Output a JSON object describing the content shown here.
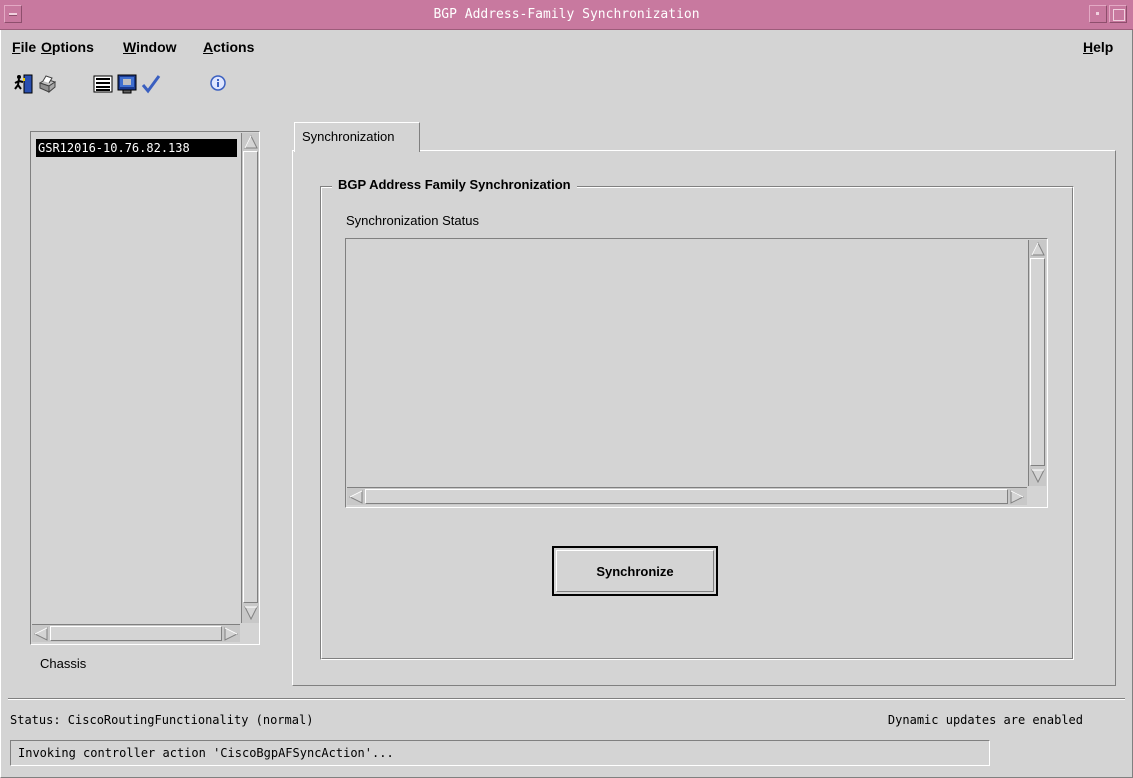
{
  "window": {
    "title": "BGP Address-Family Synchronization"
  },
  "menubar": {
    "items": [
      {
        "label": "File",
        "mnemonic": "F",
        "rest": "ile"
      },
      {
        "label": "Options",
        "mnemonic": "O",
        "rest": "ptions"
      },
      {
        "label": "Window",
        "mnemonic": "W",
        "rest": "indow"
      },
      {
        "label": "Actions",
        "mnemonic": "A",
        "rest": "ctions"
      }
    ],
    "help": {
      "label": "Help",
      "mnemonic": "H",
      "rest": "elp"
    }
  },
  "toolbar": {
    "buttons": [
      {
        "icon": "exit-icon"
      },
      {
        "icon": "print-icon"
      },
      {
        "icon": "list-icon"
      },
      {
        "icon": "monitor-icon"
      },
      {
        "icon": "checkmark-icon"
      },
      {
        "icon": "info-icon"
      }
    ]
  },
  "chassis": {
    "items": [
      "GSR12016-10.76.82.138"
    ],
    "label": "Chassis"
  },
  "tabs": [
    {
      "label": "Synchronization",
      "selected": true
    }
  ],
  "sync_panel": {
    "group_title": "BGP Address Family Synchronization",
    "status_label": "Synchronization Status",
    "status_text": "",
    "button_label": "Synchronize"
  },
  "statusbar": {
    "status": "Status: CiscoRoutingFunctionality (normal)",
    "dynamic": "Dynamic updates are enabled",
    "message": "Invoking controller action 'CiscoBgpAFSyncAction'..."
  },
  "colors": {
    "titlebar": "#c8799f",
    "background": "#d4d4d4",
    "selection": "#000000"
  }
}
